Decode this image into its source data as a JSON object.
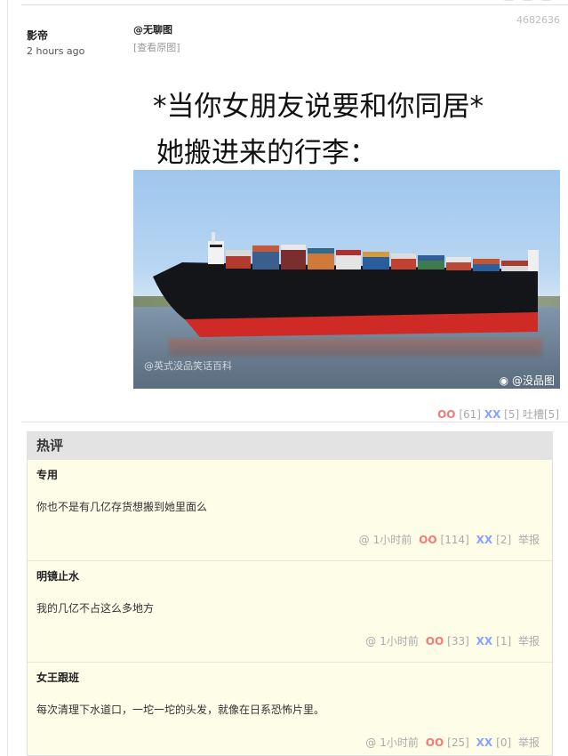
{
  "header": {
    "ghost_text": "— ·— ·—",
    "post_id": "4682636"
  },
  "author": {
    "name": "影帝",
    "time": "2 hours ago"
  },
  "post": {
    "mention": "@无聊图",
    "view_original": "[查看原图]",
    "meme_caption_line1": "*当你女朋友说要和你同居*",
    "meme_caption_line2": "她搬进来的行李：",
    "watermark_left": "@英式没品笑话百科",
    "watermark_right": "@没品图",
    "watermark_icon": "weibo-icon",
    "votes": {
      "oo_label": "OO",
      "oo_count": "[61]",
      "xx_label": "XX",
      "xx_count": "[5]",
      "tucao_label": "吐槽",
      "tucao_count": "[5]"
    }
  },
  "hot": {
    "title": "热评",
    "comments": [
      {
        "name": "专用",
        "text": "你也不是有几亿存货想搬到她里面么",
        "at": "@",
        "time": "1小时前",
        "oo": "OO",
        "oo_count": "[114]",
        "xx": "XX",
        "xx_count": "[2]",
        "report": "举报"
      },
      {
        "name": "明镜止水",
        "text": "我的几亿不占这么多地方",
        "at": "@",
        "time": "1小时前",
        "oo": "OO",
        "oo_count": "[33]",
        "xx": "XX",
        "xx_count": "[1]",
        "report": "举报"
      },
      {
        "name": "女王跟班",
        "text": "每次清理下水道口，一坨一坨的头发，就像在日系恐怖片里。",
        "at": "@",
        "time": "1小时前",
        "oo": "OO",
        "oo_count": "[25]",
        "xx": "XX",
        "xx_count": "[0]",
        "report": "举报"
      }
    ]
  },
  "colors": {
    "oo": "#f37a7a",
    "xx": "#8aa0ff",
    "comment_bg": "#fdfde8",
    "hot_header_bg": "#e3e3e3"
  }
}
